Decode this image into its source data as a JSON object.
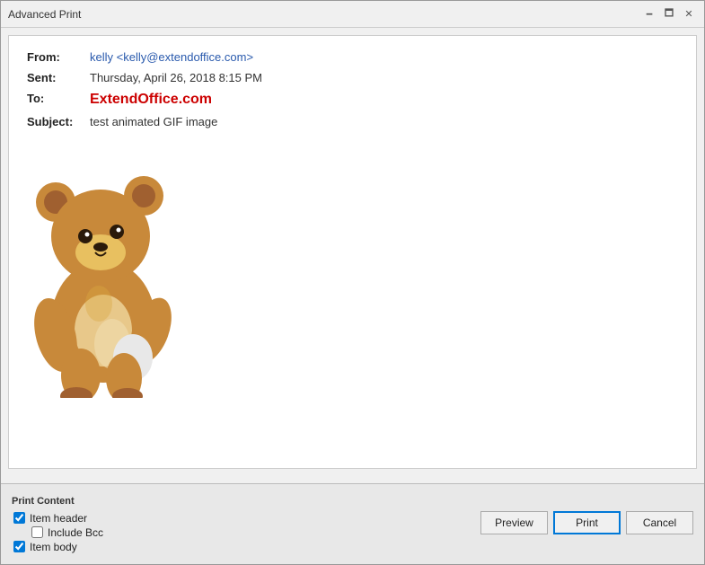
{
  "window": {
    "title": "Advanced Print"
  },
  "titlebar": {
    "title": "Advanced Print",
    "minimize_label": "🗕",
    "maximize_label": "🗖",
    "close_label": "✕"
  },
  "email": {
    "from_label": "From:",
    "from_value": "kelly <kelly@extendoffice.com>",
    "sent_label": "Sent:",
    "sent_value": "Thursday, April 26, 2018 8:15 PM",
    "to_label": "To:",
    "to_value": "ExtendOffice.com",
    "subject_label": "Subject:",
    "subject_value": "test animated GIF image"
  },
  "print_content": {
    "section_label": "Print Content",
    "item_header_label": "Item header",
    "include_bcc_label": "Include Bcc",
    "item_body_label": "Item body",
    "item_header_checked": true,
    "include_bcc_checked": false,
    "item_body_checked": true
  },
  "buttons": {
    "preview_label": "Preview",
    "print_label": "Print",
    "cancel_label": "Cancel"
  }
}
